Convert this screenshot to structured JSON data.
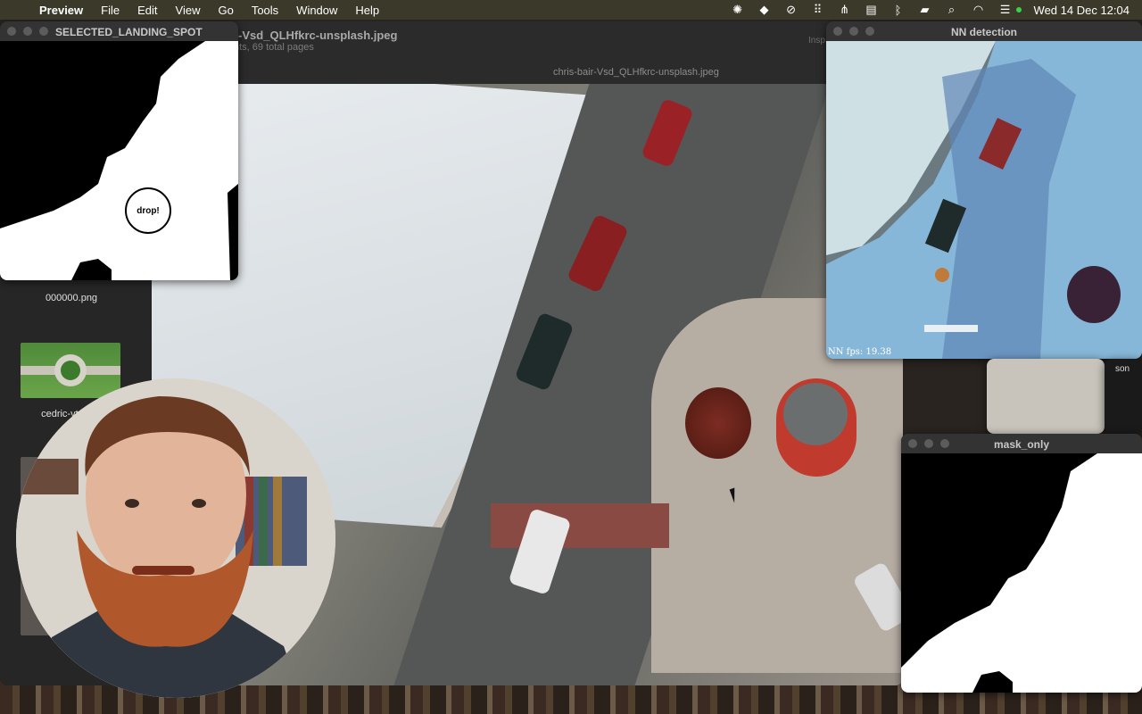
{
  "menubar": {
    "app_name": "Preview",
    "items": [
      "File",
      "Edit",
      "View",
      "Go",
      "Tools",
      "Window",
      "Help"
    ],
    "clock": "Wed 14 Dec  12:04"
  },
  "preview": {
    "title": "r-Vsd_QLHfkrc-unsplash.jpeg",
    "subtitle": "nts, 69 total pages",
    "inspector_partial": "Insp",
    "image_tab_title": "chris-bair-Vsd_QLHfkrc-unsplash.jpeg",
    "sidebar": {
      "thumbnails": [
        {
          "label": "000000.png"
        },
        {
          "label": "cedric-vt-N...s"
        }
      ]
    }
  },
  "windows": {
    "landing_spot": {
      "title": "SELECTED_LANDING_SPOT",
      "marker_label": "drop!"
    },
    "nn_detection": {
      "title": "NN detection",
      "fps_label": "NN fps: 19.38"
    },
    "mask_only": {
      "title": "mask_only"
    },
    "partial_window_label": "son"
  },
  "colors": {
    "menubar_bg": "#3b3a2a",
    "window_title_bg": "#333333",
    "mask_white": "#ffffff",
    "mask_black": "#000000",
    "nn_blue_overlay": "#9fd0f0"
  }
}
